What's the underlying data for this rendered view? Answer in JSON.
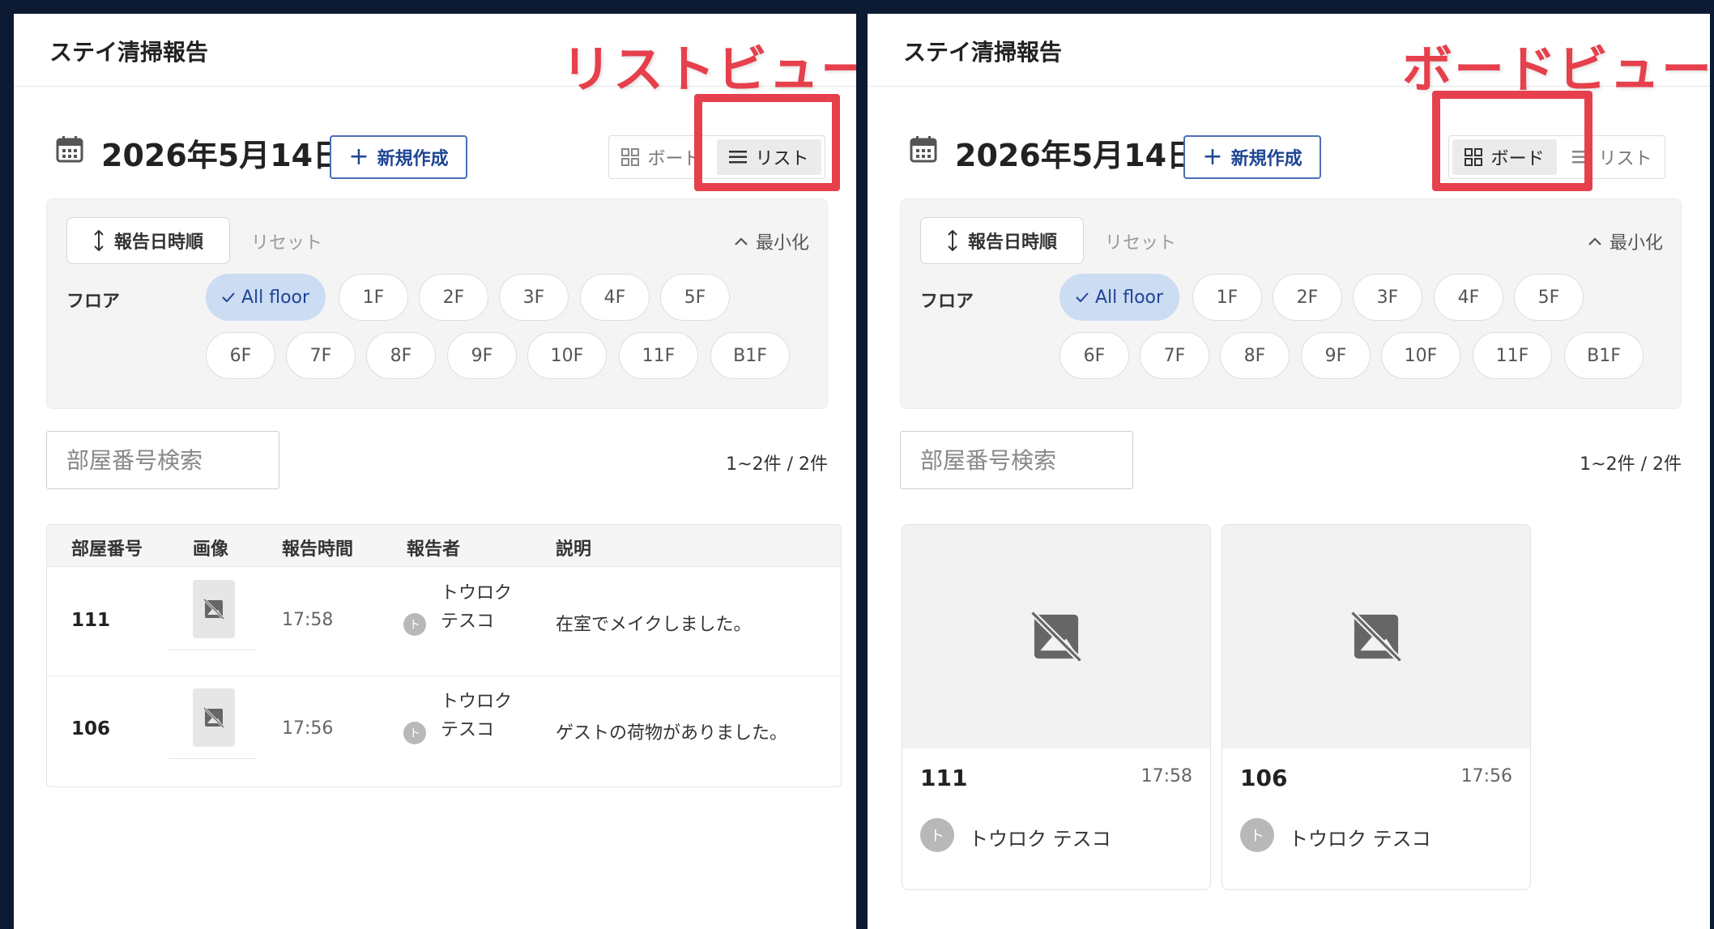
{
  "app": {
    "title": "ステイ清掃報告"
  },
  "header": {
    "date": "2026年5月14日",
    "new_button_label": "新規作成",
    "view_toggle": {
      "board_label": "ボード",
      "list_label": "リスト"
    }
  },
  "annotations": {
    "list_view_caption": "リストビュー",
    "board_view_caption": "ボードビュー",
    "highlight_color": "#e5404c"
  },
  "filters": {
    "sort_label": "報告日時順",
    "reset_label": "リセット",
    "minimize_label": "最小化",
    "floor_label": "フロア",
    "floors": [
      "All floor",
      "1F",
      "2F",
      "3F",
      "4F",
      "5F",
      "6F",
      "7F",
      "8F",
      "9F",
      "10F",
      "11F",
      "B1F"
    ],
    "selected_floor": "All floor"
  },
  "search": {
    "placeholder": "部屋番号検索"
  },
  "pagination": {
    "summary": "1~2件 / 2件"
  },
  "list_view": {
    "columns": [
      "部屋番号",
      "画像",
      "報告時間",
      "報告者",
      "説明"
    ]
  },
  "reports": [
    {
      "room": "111",
      "time": "17:58",
      "reporter": "トウロク テスコ",
      "reporter_wrapped": "トウロク テスコ",
      "avatar_initial": "ト",
      "description": "在室でメイクしました。"
    },
    {
      "room": "106",
      "time": "17:56",
      "reporter": "トウロク テスコ",
      "reporter_wrapped": "トウロク テスコ",
      "avatar_initial": "ト",
      "description": "ゲストの荷物がありました。"
    }
  ],
  "colors": {
    "accent": "#1e4594",
    "selected_chip_bg": "#cbdcf3",
    "background": "#0c1a33"
  }
}
